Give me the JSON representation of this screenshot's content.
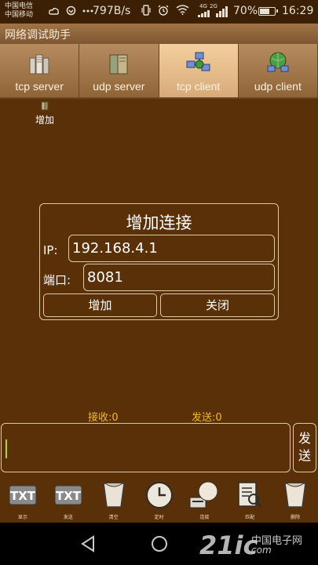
{
  "status_bar": {
    "carrier_1": "中国电信",
    "carrier_2": "中国移动",
    "icons": [
      "weather-icon",
      "sync-icon",
      "more-icon"
    ],
    "net_speed": "797B/s",
    "right_icons": [
      "vibrate-icon",
      "alarm-icon",
      "wifi-icon"
    ],
    "net_4g": "4G",
    "net_2g": "2G",
    "battery_level": 0.7,
    "battery_text": "70%",
    "time": "16:29"
  },
  "app": {
    "title": "网络调试助手"
  },
  "tabs": [
    {
      "label": "tcp server",
      "icon": "server-stack-icon",
      "active": false
    },
    {
      "label": "udp server",
      "icon": "book-server-icon",
      "active": false
    },
    {
      "label": "tcp client",
      "icon": "network-client-icon",
      "active": true
    },
    {
      "label": "udp client",
      "icon": "globe-client-icon",
      "active": false
    }
  ],
  "add_connection": {
    "label": "增加",
    "icon": "add-connection-icon"
  },
  "dialog": {
    "title": "增加连接",
    "ip_label": "IP:",
    "ip_value": "192.168.4.1",
    "port_label": "端口:",
    "port_value": "8081",
    "add_button": "增加",
    "close_button": "关闭"
  },
  "counters": {
    "received": "接收:0",
    "sent": "发送:0"
  },
  "send": {
    "input_value": "",
    "button": "发送"
  },
  "toolbar": [
    {
      "label": "显示",
      "icon": "txt-display-icon"
    },
    {
      "label": "发送",
      "icon": "txt-send-icon"
    },
    {
      "label": "清空",
      "icon": "clear-cup-icon"
    },
    {
      "label": "定时",
      "icon": "clock-icon"
    },
    {
      "label": "连接",
      "icon": "connect-icon"
    },
    {
      "label": "匹配",
      "icon": "match-document-icon"
    },
    {
      "label": "删除",
      "icon": "delete-cup-icon"
    }
  ],
  "nav": {
    "icons": [
      "back-icon",
      "home-icon",
      "recents-icon"
    ]
  },
  "watermark": {
    "logo": "21ic",
    "site_cn": "中国电子网",
    "site_url": "com"
  }
}
